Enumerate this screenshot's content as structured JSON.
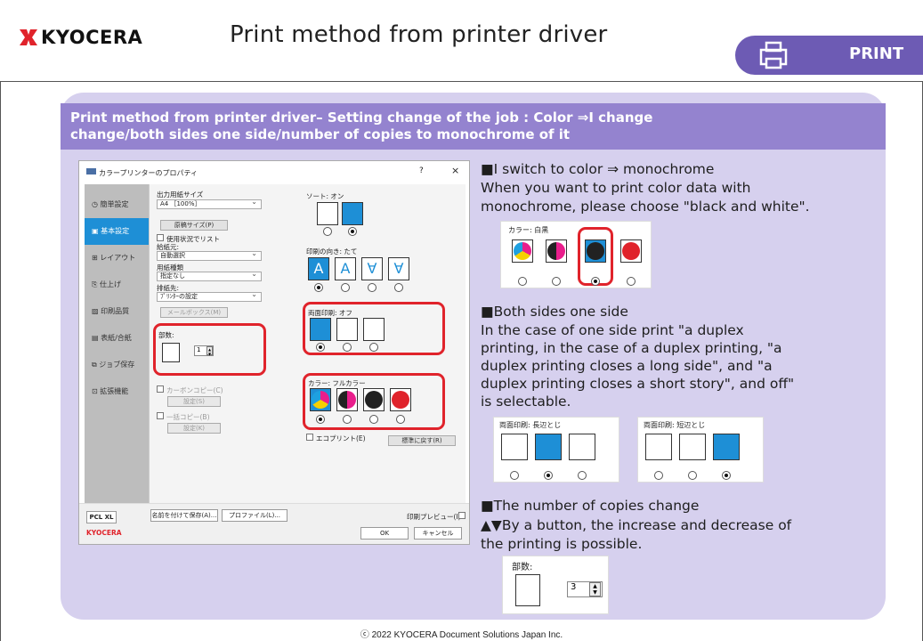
{
  "header": {
    "logo": "KYOCERA",
    "title": "Print method from printer driver",
    "print_label": "PRINT"
  },
  "banner": {
    "line1": "Print method from printer driver– Setting change of the job : Color ⇒I change",
    "line2": "change/both sides one side/number of copies to monochrome of it"
  },
  "dialog": {
    "title": "カラープリンターのプロパティ",
    "help": "?",
    "close": "×",
    "nav": [
      "簡単設定",
      "基本設定",
      "レイアウト",
      "仕上げ",
      "印刷品質",
      "表紙/合紙",
      "ジョブ保存",
      "拡張機能"
    ],
    "paper_size_label": "出力用紙サイズ",
    "paper_size_value": "A4 ［100%］",
    "original_size_btn": "原稿サイズ(P)",
    "list_by_usage": "使用状況でリスト",
    "source_label": "給紙元:",
    "source_value": "自動選択",
    "media_label": "用紙種類",
    "media_value": "指定なし",
    "output_label": "排紙先:",
    "output_value": "ﾌﾟﾘﾝﾀｰの設定",
    "mailbox_btn": "メールボックス(M)",
    "copies_label": "部数:",
    "copies_value": "1",
    "carbon_copy": "カーボンコピー(C)",
    "settings_btn": "設定(S)",
    "batch_copy": "一括コピー(B)",
    "settings_k_btn": "設定(K)",
    "sort_label": "ソート: オン",
    "orientation_label": "印刷の向き: たて",
    "duplex_label": "両面印刷: オフ",
    "color_label": "カラー: フルカラー",
    "ecoprint": "エコプリント(E)",
    "reset_btn": "標準に戻す(R)",
    "pcl_btn": "PCL XL",
    "save_as_btn": "名前を付けて保存(A)...",
    "profile_btn": "プロファイル(L)...",
    "preview_label": "印刷プレビュー(I)",
    "footer_logo": "KYOCERA",
    "ok_btn": "OK",
    "cancel_btn": "キャンセル"
  },
  "right": {
    "s1_title": "■I switch to color ⇒ monochrome",
    "s1_text1": "When you want to print color data with",
    "s1_text2": "monochrome, please choose \"black and white\".",
    "color_bw_label": "カラー: 白黒",
    "s2_title": "■Both sides one side",
    "s2_l1": "In the case of one side print \"a duplex",
    "s2_l2": "printing, in the case of a duplex printing, \"a",
    "s2_l3": "duplex printing closes a long side\", and \"a",
    "s2_l4": "duplex printing closes a short story\", and off\"",
    "s2_l5": "is selectable.",
    "duplex_long_label": "両面印刷: 長辺とじ",
    "duplex_short_label": "両面印刷: 短辺とじ",
    "s3_title": "■The number of copies change",
    "s3_l1": "▲▼By a button, the increase and decrease of",
    "s3_l2": "the printing is possible.",
    "copies_label": "部数:",
    "copies_value": "3"
  },
  "copyright": "ⓒ 2022 KYOCERA Document Solutions Japan Inc.",
  "colors": {
    "purple_banner": "#9483cf",
    "panel": "#d6d0ee",
    "print_box": "#6d5bb4",
    "highlight": "#e0232b",
    "selected": "#1e8fd6",
    "logo_red": "#e0232b"
  }
}
